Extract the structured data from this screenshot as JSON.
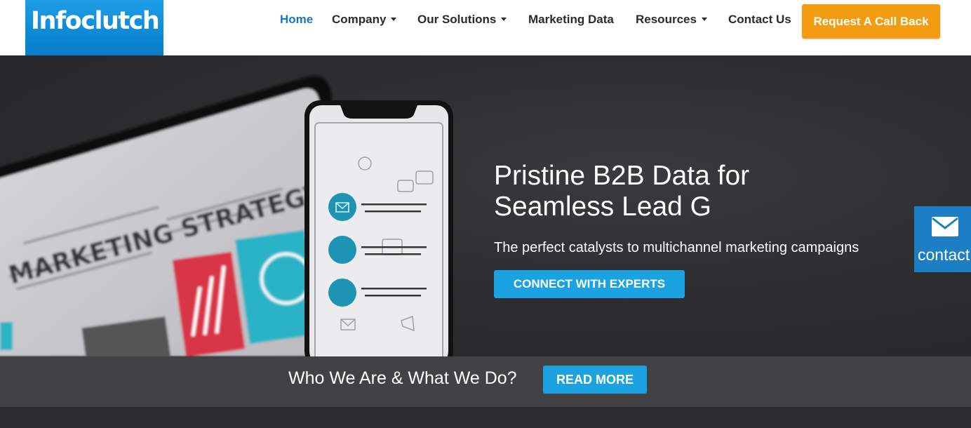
{
  "brand": {
    "logo_text": "Infoclutch"
  },
  "nav": {
    "items": [
      {
        "label": "Home",
        "dropdown": false,
        "active": true
      },
      {
        "label": "Company",
        "dropdown": true,
        "active": false
      },
      {
        "label": "Our Solutions",
        "dropdown": true,
        "active": false
      },
      {
        "label": "Marketing Data",
        "dropdown": false,
        "active": false
      },
      {
        "label": "Resources",
        "dropdown": true,
        "active": false
      },
      {
        "label": "Contact Us",
        "dropdown": false,
        "active": false
      }
    ],
    "cta_label": "Request A Call Back"
  },
  "hero": {
    "title_line1": "Pristine B2B Data for",
    "title_line2": "Seamless Lead G",
    "subtitle": "The perfect catalysts to multichannel marketing campaigns",
    "button_label": "CONNECT WITH EXPERTS",
    "image_text": "MARKETING STRATEGY"
  },
  "contact_tab": {
    "label": "contact",
    "icon": "envelope-icon"
  },
  "strip": {
    "text": "Who We Are & What We Do?",
    "button_label": "READ MORE"
  },
  "colors": {
    "brand_blue": "#0a86d4",
    "accent_orange": "#f39c12",
    "button_blue": "#1aa3e0",
    "nav_active": "#1c75bc"
  }
}
